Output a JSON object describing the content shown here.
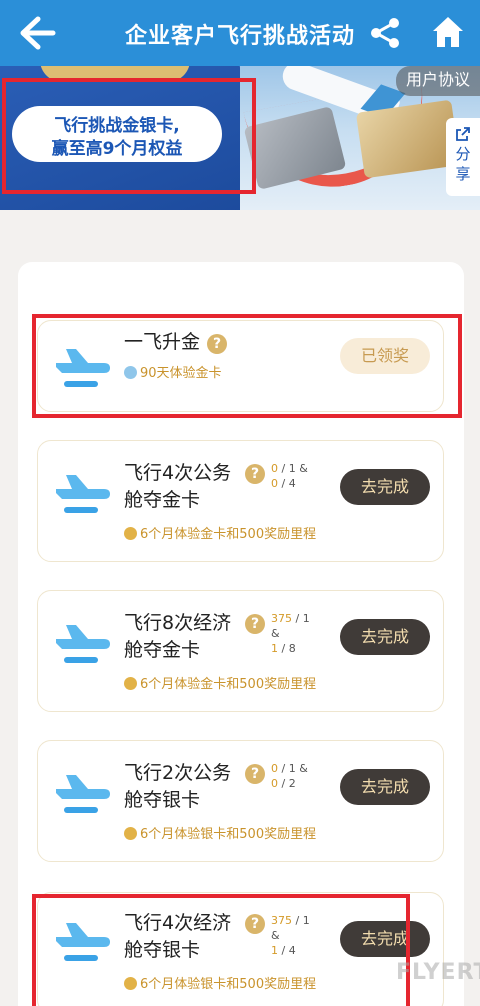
{
  "header": {
    "title": "企业客户飞行挑战活动",
    "back_icon": "back-arrow-icon",
    "share_icon": "share-icon",
    "home_icon": "home-icon"
  },
  "banner": {
    "pill_line1": "飞行挑战金银卡,",
    "pill_line2": "赢至高9个月权益",
    "agreement_label": "用户协议",
    "share_label_1": "分",
    "share_label_2": "享"
  },
  "tasks": [
    {
      "name_line1": "一飞升金",
      "name_line2": "",
      "reward": "90天体验金卡",
      "button": "已领奖",
      "progress": []
    },
    {
      "name_line1": "飞行4次公务",
      "name_line2": "舱夺金卡",
      "reward": "6个月体验金卡和500奖励里程",
      "button": "去完成",
      "progress": [
        {
          "done": "0",
          "target": "/ 1 &"
        },
        {
          "done": "0",
          "target": "/ 4"
        }
      ]
    },
    {
      "name_line1": "飞行8次经济",
      "name_line2": "舱夺金卡",
      "reward": "6个月体验金卡和500奖励里程",
      "button": "去完成",
      "progress": [
        {
          "done": "375",
          "target": "/ 1"
        },
        {
          "done": "&",
          "target": ""
        },
        {
          "done": "1",
          "target": "/ 8"
        }
      ]
    },
    {
      "name_line1": "飞行2次公务",
      "name_line2": "舱夺银卡",
      "reward": "6个月体验银卡和500奖励里程",
      "button": "去完成",
      "progress": [
        {
          "done": "0",
          "target": "/ 1 &"
        },
        {
          "done": "0",
          "target": "/ 2"
        }
      ]
    },
    {
      "name_line1": "飞行4次经济",
      "name_line2": "舱夺银卡",
      "reward": "6个月体验银卡和500奖励里程",
      "button": "去完成",
      "progress": [
        {
          "done": "375",
          "target": "/ 1"
        },
        {
          "done": "&",
          "target": ""
        },
        {
          "done": "1",
          "target": "/ 4"
        }
      ]
    }
  ],
  "question_mark": "?",
  "watermark": "FLYERT",
  "colors": {
    "header_bg": "#2b8fd8",
    "highlight_box": "#e5262f",
    "reward_gold": "#c9932c",
    "button_dark": "#403b38"
  }
}
